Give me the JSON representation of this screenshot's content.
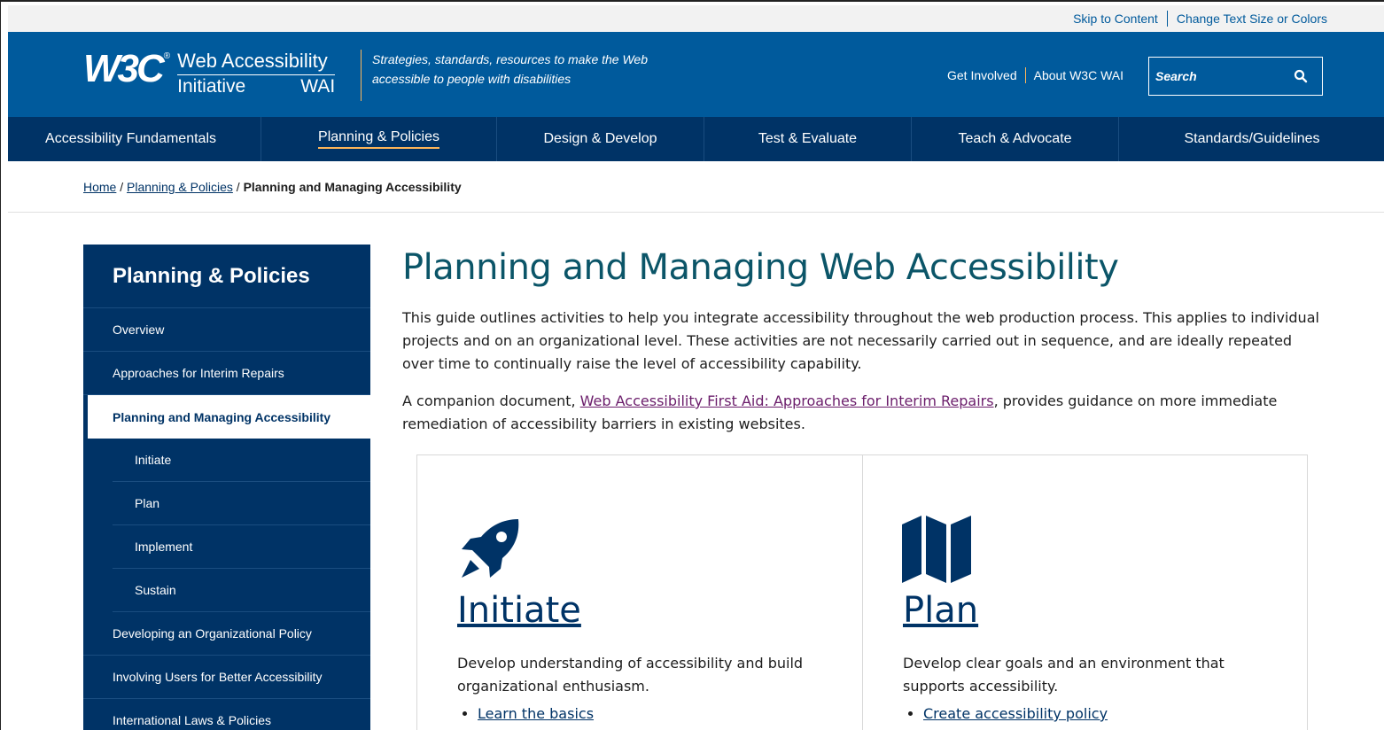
{
  "utility": {
    "skip_label": "Skip to Content",
    "textsize_label": "Change Text Size or Colors"
  },
  "header": {
    "logo_w3c": "W3C",
    "logo_reg": "®",
    "logo_line1": "Web Accessibility",
    "logo_line2a": "Initiative",
    "logo_line2b": "WAI",
    "tagline_line1": "Strategies, standards, resources to make the Web",
    "tagline_line2": "accessible to people with disabilities",
    "get_involved": "Get Involved",
    "about": "About W3C WAI",
    "search_placeholder": "Search",
    "search_icon": "search-icon"
  },
  "nav": {
    "items": [
      {
        "label": "Accessibility Fundamentals"
      },
      {
        "label": "Planning & Policies"
      },
      {
        "label": "Design & Develop"
      },
      {
        "label": "Test & Evaluate"
      },
      {
        "label": "Teach & Advocate"
      },
      {
        "label": "Standards/Guidelines"
      }
    ],
    "active_index": 1
  },
  "breadcrumb": {
    "home": "Home",
    "sep": " / ",
    "section": "Planning & Policies",
    "current": "Planning and Managing Accessibility"
  },
  "sidebar": {
    "title": "Planning & Policies",
    "items": [
      {
        "label": "Overview"
      },
      {
        "label": "Approaches for Interim Repairs"
      },
      {
        "label": "Planning and Managing Accessibility"
      },
      {
        "label": "Initiate"
      },
      {
        "label": "Plan"
      },
      {
        "label": "Implement"
      },
      {
        "label": "Sustain"
      },
      {
        "label": "Developing an Organizational Policy"
      },
      {
        "label": "Involving Users for Better Accessibility"
      },
      {
        "label": "International Laws & Policies"
      }
    ]
  },
  "main": {
    "title": "Planning and Managing Web Accessibility",
    "intro": "This guide outlines activities to help you integrate accessibility throughout the web production process. This applies to individual projects and on an organizational level. These activities are not necessarily carried out in sequence, and are ideally repeated over time to continually raise the level of accessibility capability.",
    "companion_before": "A companion document, ",
    "companion_link": "Web Accessibility First Aid: Approaches for Interim Repairs",
    "companion_after": ", provides guidance on more immediate remediation of accessibility barriers in existing websites.",
    "cards": [
      {
        "icon": "rocket-icon",
        "title": "Initiate",
        "desc": "Develop understanding of accessibility and build organizational enthusiasm.",
        "links": [
          "Learn the basics"
        ]
      },
      {
        "icon": "map-icon",
        "title": "Plan",
        "desc": "Develop clear goals and an environment that supports accessibility.",
        "links": [
          "Create accessibility policy"
        ]
      }
    ]
  },
  "colors": {
    "header_blue": "#005a9c",
    "nav_navy": "#003366",
    "accent_gold": "#fcb55a",
    "link_visited": "#6b1d6b"
  }
}
